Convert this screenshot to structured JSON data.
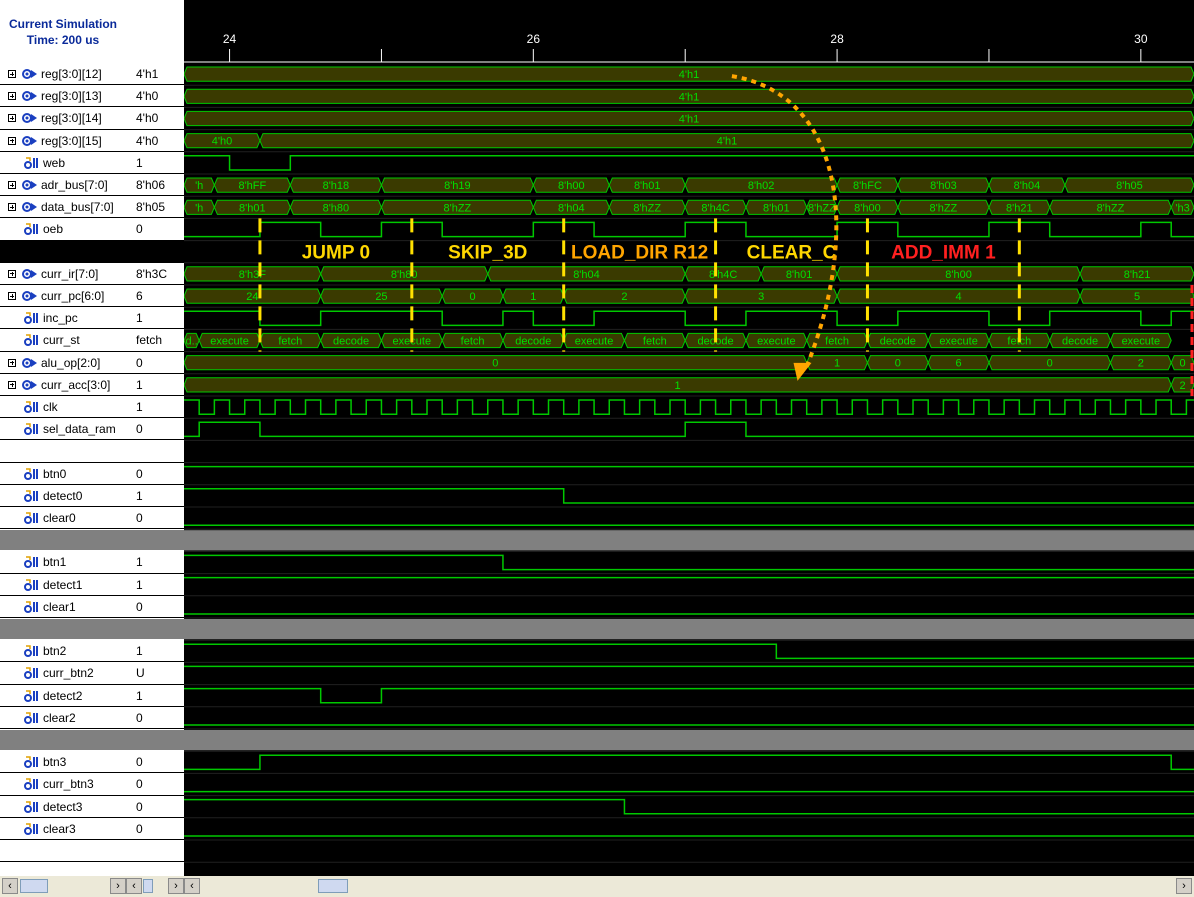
{
  "header": {
    "title": "Current Simulation\nTime: 200 us"
  },
  "timeline": {
    "start": 23.7,
    "end": 30.35,
    "ticks": [
      {
        "t": 24,
        "label": "24"
      },
      {
        "t": 25,
        "label": ""
      },
      {
        "t": 26,
        "label": "26"
      },
      {
        "t": 27,
        "label": ""
      },
      {
        "t": 28,
        "label": "28"
      },
      {
        "t": 29,
        "label": ""
      },
      {
        "t": 30,
        "label": "30"
      }
    ]
  },
  "colors": {
    "wave": "#00c800",
    "bus_fill": "#3a3a00",
    "bus_text": "#00e000",
    "instr_yellow": "#ffd700",
    "instr_orange": "#ffa500",
    "instr_red": "#ff2020",
    "arrow": "#ffa500",
    "sep_gray": "#808080",
    "marker_yellow": "#ffe000"
  },
  "signals": [
    {
      "name": "reg[3:0][12]",
      "value": "4'h1",
      "icon": "bus-icon",
      "expandable": true,
      "kind": "bus",
      "segs": [
        {
          "s": 23.7,
          "e": 30.35,
          "label": "4'h1"
        }
      ]
    },
    {
      "name": "reg[3:0][13]",
      "value": "4'h0",
      "icon": "bus-icon",
      "expandable": true,
      "kind": "bus",
      "segs": [
        {
          "s": 23.7,
          "e": 30.35,
          "label": "4'h1"
        }
      ]
    },
    {
      "name": "reg[3:0][14]",
      "value": "4'h0",
      "icon": "bus-icon",
      "expandable": true,
      "kind": "bus",
      "segs": [
        {
          "s": 23.7,
          "e": 30.35,
          "label": "4'h1"
        }
      ]
    },
    {
      "name": "reg[3:0][15]",
      "value": "4'h0",
      "icon": "bus-icon",
      "expandable": true,
      "kind": "bus",
      "segs": [
        {
          "s": 23.7,
          "e": 24.2,
          "label": "4'h0"
        },
        {
          "s": 24.2,
          "e": 30.35,
          "label": "4'h1"
        }
      ]
    },
    {
      "name": "web",
      "value": "1",
      "icon": "signal-icon",
      "expandable": false,
      "kind": "bit",
      "steps": [
        [
          23.7,
          1
        ],
        [
          24,
          0
        ],
        [
          24.4,
          1
        ]
      ]
    },
    {
      "name": "adr_bus[7:0]",
      "value": "8'h06",
      "icon": "bus-icon",
      "expandable": true,
      "kind": "bus",
      "segs": [
        {
          "s": 23.7,
          "e": 23.9,
          "label": "'h"
        },
        {
          "s": 23.9,
          "e": 24.4,
          "label": "8'hFF"
        },
        {
          "s": 24.4,
          "e": 25,
          "label": "8'h18"
        },
        {
          "s": 25,
          "e": 26,
          "label": "8'h19"
        },
        {
          "s": 26,
          "e": 26.5,
          "label": "8'h00"
        },
        {
          "s": 26.5,
          "e": 27,
          "label": "8'h01"
        },
        {
          "s": 27,
          "e": 28,
          "label": "8'h02"
        },
        {
          "s": 28,
          "e": 28.4,
          "label": "8'hFC"
        },
        {
          "s": 28.4,
          "e": 29,
          "label": "8'h03"
        },
        {
          "s": 29,
          "e": 29.5,
          "label": "8'h04"
        },
        {
          "s": 29.5,
          "e": 30.35,
          "label": "8'h05"
        }
      ]
    },
    {
      "name": "data_bus[7:0]",
      "value": "8'h05",
      "icon": "bus-icon",
      "expandable": true,
      "kind": "bus",
      "segs": [
        {
          "s": 23.7,
          "e": 23.9,
          "label": "'h"
        },
        {
          "s": 23.9,
          "e": 24.4,
          "label": "8'h01"
        },
        {
          "s": 24.4,
          "e": 25,
          "label": "8'h80"
        },
        {
          "s": 25,
          "e": 26,
          "label": "8'hZZ"
        },
        {
          "s": 26,
          "e": 26.5,
          "label": "8'h04"
        },
        {
          "s": 26.5,
          "e": 27,
          "label": "8'hZZ"
        },
        {
          "s": 27,
          "e": 27.4,
          "label": "8'h4C"
        },
        {
          "s": 27.4,
          "e": 27.8,
          "label": "8'h01"
        },
        {
          "s": 27.8,
          "e": 28,
          "label": "8'hZZ"
        },
        {
          "s": 28,
          "e": 28.4,
          "label": "8'h00"
        },
        {
          "s": 28.4,
          "e": 29,
          "label": "8'hZZ"
        },
        {
          "s": 29,
          "e": 29.4,
          "label": "8'h21"
        },
        {
          "s": 29.4,
          "e": 30.2,
          "label": "8'hZZ"
        },
        {
          "s": 30.2,
          "e": 30.35,
          "label": "'h3"
        }
      ]
    },
    {
      "name": "oeb",
      "value": "0",
      "icon": "signal-icon",
      "expandable": false,
      "kind": "bit",
      "steps": [
        [
          23.7,
          0
        ],
        [
          24.2,
          1
        ],
        [
          24.6,
          0
        ],
        [
          25,
          1
        ],
        [
          25.4,
          0
        ],
        [
          26,
          1
        ],
        [
          26.4,
          0
        ],
        [
          27,
          1
        ],
        [
          27.4,
          0
        ],
        [
          28,
          1
        ],
        [
          28.4,
          0
        ],
        [
          29,
          1
        ],
        [
          29.4,
          0
        ],
        [
          30,
          1
        ],
        [
          30.2,
          0
        ]
      ]
    },
    {
      "name": "",
      "value": "",
      "icon": "",
      "expandable": false,
      "kind": "annot",
      "instructions": [
        {
          "s": 24.2,
          "e": 25.2,
          "label": "JUMP 0",
          "color": "instr_yellow"
        },
        {
          "s": 25.2,
          "e": 26.2,
          "label": "SKIP_3D",
          "color": "instr_yellow"
        },
        {
          "s": 26.2,
          "e": 27.2,
          "label": "LOAD_DIR  R12",
          "color": "instr_orange"
        },
        {
          "s": 27.2,
          "e": 28.2,
          "label": "CLEAR_C",
          "color": "instr_yellow"
        },
        {
          "s": 28.2,
          "e": 29.2,
          "label": "ADD_IMM 1",
          "color": "instr_red"
        }
      ]
    },
    {
      "name": "curr_ir[7:0]",
      "value": "8'h3C",
      "icon": "bus-icon",
      "expandable": true,
      "kind": "bus",
      "segs": [
        {
          "s": 23.7,
          "e": 24.6,
          "label": "8'h3F"
        },
        {
          "s": 24.6,
          "e": 25.7,
          "label": "8'h80"
        },
        {
          "s": 25.7,
          "e": 27,
          "label": "8'h04"
        },
        {
          "s": 27,
          "e": 27.5,
          "label": "8'h4C"
        },
        {
          "s": 27.5,
          "e": 28,
          "label": "8'h01"
        },
        {
          "s": 28,
          "e": 29.6,
          "label": "8'h00"
        },
        {
          "s": 29.6,
          "e": 30.35,
          "label": "8'h21"
        }
      ]
    },
    {
      "name": "curr_pc[6:0]",
      "value": "6",
      "icon": "bus-icon",
      "expandable": true,
      "kind": "bus",
      "segs": [
        {
          "s": 23.7,
          "e": 24.6,
          "label": "24"
        },
        {
          "s": 24.6,
          "e": 25.4,
          "label": "25"
        },
        {
          "s": 25.4,
          "e": 25.8,
          "label": "0"
        },
        {
          "s": 25.8,
          "e": 26.2,
          "label": "1"
        },
        {
          "s": 26.2,
          "e": 27,
          "label": "2"
        },
        {
          "s": 27,
          "e": 28,
          "label": "3"
        },
        {
          "s": 28,
          "e": 29.6,
          "label": "4"
        },
        {
          "s": 29.6,
          "e": 30.35,
          "label": "5"
        }
      ]
    },
    {
      "name": "inc_pc",
      "value": "1",
      "icon": "signal-icon",
      "expandable": false,
      "kind": "bit",
      "steps": [
        [
          23.7,
          1
        ],
        [
          24.2,
          0
        ],
        [
          24.6,
          1
        ],
        [
          25.4,
          0
        ],
        [
          25.8,
          1
        ],
        [
          26,
          0
        ],
        [
          26.4,
          1
        ],
        [
          27,
          0
        ],
        [
          27.4,
          1
        ],
        [
          28,
          0
        ],
        [
          28.4,
          1
        ],
        [
          29,
          0
        ],
        [
          29.4,
          1
        ],
        [
          30,
          0
        ],
        [
          30.2,
          1
        ]
      ]
    },
    {
      "name": "curr_st",
      "value": "fetch",
      "icon": "signal-icon",
      "expandable": false,
      "kind": "bus",
      "segs": [
        {
          "s": 23.7,
          "e": 23.8,
          "label": "d.."
        },
        {
          "s": 23.8,
          "e": 24.2,
          "label": "execute"
        },
        {
          "s": 24.2,
          "e": 24.6,
          "label": "fetch"
        },
        {
          "s": 24.6,
          "e": 25,
          "label": "decode"
        },
        {
          "s": 25,
          "e": 25.4,
          "label": "execute"
        },
        {
          "s": 25.4,
          "e": 25.8,
          "label": "fetch"
        },
        {
          "s": 25.8,
          "e": 26.2,
          "label": "decode"
        },
        {
          "s": 26.2,
          "e": 26.6,
          "label": "execute"
        },
        {
          "s": 26.6,
          "e": 27,
          "label": "fetch"
        },
        {
          "s": 27,
          "e": 27.4,
          "label": "decode"
        },
        {
          "s": 27.4,
          "e": 27.8,
          "label": "execute"
        },
        {
          "s": 27.8,
          "e": 28.2,
          "label": "fetch"
        },
        {
          "s": 28.2,
          "e": 28.6,
          "label": "decode"
        },
        {
          "s": 28.6,
          "e": 29,
          "label": "execute"
        },
        {
          "s": 29,
          "e": 29.4,
          "label": "fetch"
        },
        {
          "s": 29.4,
          "e": 29.8,
          "label": "decode"
        },
        {
          "s": 29.8,
          "e": 30.2,
          "label": "execute"
        }
      ]
    },
    {
      "name": "alu_op[2:0]",
      "value": "0",
      "icon": "bus-icon",
      "expandable": true,
      "kind": "bus",
      "segs": [
        {
          "s": 23.7,
          "e": 27.8,
          "label": "0"
        },
        {
          "s": 27.8,
          "e": 28.2,
          "label": "1"
        },
        {
          "s": 28.2,
          "e": 28.6,
          "label": "0"
        },
        {
          "s": 28.6,
          "e": 29,
          "label": "6"
        },
        {
          "s": 29,
          "e": 29.8,
          "label": "0"
        },
        {
          "s": 29.8,
          "e": 30.2,
          "label": "2"
        },
        {
          "s": 30.2,
          "e": 30.35,
          "label": "0"
        }
      ]
    },
    {
      "name": "curr_acc[3:0]",
      "value": "1",
      "icon": "bus-icon",
      "expandable": true,
      "kind": "bus",
      "segs": [
        {
          "s": 23.7,
          "e": 30.2,
          "label": "1"
        },
        {
          "s": 30.2,
          "e": 30.35,
          "label": "2"
        }
      ]
    },
    {
      "name": "clk",
      "value": "1",
      "icon": "signal-icon",
      "expandable": false,
      "kind": "clock",
      "period": 0.2,
      "first": 23.7
    },
    {
      "name": "sel_data_ram",
      "value": "0",
      "icon": "signal-icon",
      "expandable": false,
      "kind": "bit",
      "steps": [
        [
          23.7,
          0
        ],
        [
          23.8,
          1
        ],
        [
          24.2,
          0
        ],
        [
          27,
          1
        ],
        [
          27.4,
          0
        ]
      ]
    },
    {
      "name": "",
      "value": "",
      "icon": "",
      "expandable": false,
      "kind": "blank"
    },
    {
      "name": "btn0",
      "value": "0",
      "icon": "signal-icon",
      "expandable": false,
      "kind": "bit",
      "steps": [
        [
          23.7,
          1
        ]
      ]
    },
    {
      "name": "detect0",
      "value": "1",
      "icon": "signal-icon",
      "expandable": false,
      "kind": "bit",
      "steps": [
        [
          23.7,
          1
        ],
        [
          26.2,
          0
        ]
      ]
    },
    {
      "name": "clear0",
      "value": "0",
      "icon": "signal-icon",
      "expandable": false,
      "kind": "bit",
      "steps": [
        [
          23.7,
          0
        ]
      ]
    },
    {
      "name": "",
      "value": "",
      "icon": "",
      "expandable": false,
      "kind": "sep"
    },
    {
      "name": "btn1",
      "value": "1",
      "icon": "signal-icon",
      "expandable": false,
      "kind": "bit",
      "steps": [
        [
          23.7,
          1
        ],
        [
          25.8,
          0
        ]
      ]
    },
    {
      "name": "detect1",
      "value": "1",
      "icon": "signal-icon",
      "expandable": false,
      "kind": "bit",
      "steps": [
        [
          23.7,
          1
        ]
      ]
    },
    {
      "name": "clear1",
      "value": "0",
      "icon": "signal-icon",
      "expandable": false,
      "kind": "bit",
      "steps": [
        [
          23.7,
          0
        ]
      ]
    },
    {
      "name": "",
      "value": "",
      "icon": "",
      "expandable": false,
      "kind": "sep"
    },
    {
      "name": "btn2",
      "value": "1",
      "icon": "signal-icon",
      "expandable": false,
      "kind": "bit",
      "steps": [
        [
          23.7,
          1
        ],
        [
          27.6,
          0
        ]
      ]
    },
    {
      "name": "curr_btn2",
      "value": "U",
      "icon": "signal-icon",
      "expandable": false,
      "kind": "bit",
      "steps": [
        [
          23.7,
          1
        ]
      ]
    },
    {
      "name": "detect2",
      "value": "1",
      "icon": "signal-icon",
      "expandable": false,
      "kind": "bit",
      "steps": [
        [
          23.7,
          1
        ],
        [
          24.6,
          0
        ],
        [
          25,
          1
        ]
      ]
    },
    {
      "name": "clear2",
      "value": "0",
      "icon": "signal-icon",
      "expandable": false,
      "kind": "bit",
      "steps": [
        [
          23.7,
          0
        ]
      ]
    },
    {
      "name": "",
      "value": "",
      "icon": "",
      "expandable": false,
      "kind": "sep"
    },
    {
      "name": "btn3",
      "value": "0",
      "icon": "signal-icon",
      "expandable": false,
      "kind": "bit",
      "steps": [
        [
          23.7,
          0
        ],
        [
          24.2,
          1
        ],
        [
          30.2,
          0
        ]
      ]
    },
    {
      "name": "curr_btn3",
      "value": "0",
      "icon": "signal-icon",
      "expandable": false,
      "kind": "bit",
      "steps": [
        [
          23.7,
          0
        ]
      ]
    },
    {
      "name": "detect3",
      "value": "0",
      "icon": "signal-icon",
      "expandable": false,
      "kind": "bit",
      "steps": [
        [
          23.7,
          1
        ],
        [
          26.6,
          0
        ]
      ]
    },
    {
      "name": "clear3",
      "value": "0",
      "icon": "signal-icon",
      "expandable": false,
      "kind": "bit",
      "steps": [
        [
          23.7,
          0
        ]
      ]
    },
    {
      "name": "",
      "value": "",
      "icon": "",
      "expandable": false,
      "kind": "blank"
    }
  ],
  "markers": [
    24.2,
    25.2,
    26.2,
    27.2,
    28.2,
    29.2
  ],
  "red_marker": 30.35,
  "scrollbar": {
    "left_arrow": "‹",
    "right_arrow": "›"
  }
}
